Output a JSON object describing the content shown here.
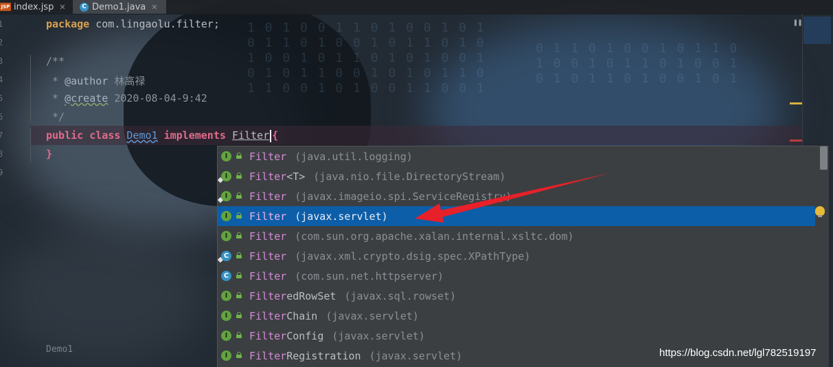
{
  "tabs": [
    {
      "label": "index.jsp",
      "icon": "JSP",
      "close": "✕"
    },
    {
      "label": "Demo1.java",
      "icon": "C",
      "close": "✕"
    }
  ],
  "line_numbers": [
    "1",
    "2",
    "3",
    "4",
    "5",
    "6",
    "7",
    "8",
    "9"
  ],
  "code": {
    "package_kw": "package",
    "package_name": " com.lingaolu.filter;",
    "doc_open": "/**",
    "author_prefix": " * ",
    "author_tag": "@author",
    "author_value": " 林高禄",
    "create_prefix": " * ",
    "create_tag": "@create",
    "create_value": " 2020-08-04-9:42",
    "doc_close": " */",
    "public_kw": "public",
    "class_kw": "class",
    "class_name": "Demo1",
    "implements_kw": "implements",
    "typed": "Filter",
    "open_brace": "{",
    "close_brace": "}"
  },
  "breadcrumb": "Demo1",
  "completion": {
    "items": [
      {
        "match": "Filter",
        "rest": "",
        "pkg": "(java.util.logging)",
        "icon": "I",
        "selected": false
      },
      {
        "match": "Filter",
        "rest": "<T>",
        "pkg": "(java.nio.file.DirectoryStream)",
        "icon": "I",
        "selected": false
      },
      {
        "match": "Filter",
        "rest": "",
        "pkg": "(javax.imageio.spi.ServiceRegistry)",
        "icon": "I",
        "selected": false
      },
      {
        "match": "Filter",
        "rest": "",
        "pkg": "(javax.servlet)",
        "icon": "I",
        "selected": true
      },
      {
        "match": "Filter",
        "rest": "",
        "pkg": "(com.sun.org.apache.xalan.internal.xsltc.dom)",
        "icon": "I",
        "selected": false
      },
      {
        "match": "Filter",
        "rest": "",
        "pkg": "(javax.xml.crypto.dsig.spec.XPathType)",
        "icon": "C",
        "selected": false
      },
      {
        "match": "Filter",
        "rest": "",
        "pkg": "(com.sun.net.httpserver)",
        "icon": "C",
        "selected": false
      },
      {
        "match": "Filter",
        "rest": "edRowSet",
        "pkg": "(javax.sql.rowset)",
        "icon": "I",
        "selected": false
      },
      {
        "match": "Filter",
        "rest": "Chain",
        "pkg": "(javax.servlet)",
        "icon": "I",
        "selected": false
      },
      {
        "match": "Filter",
        "rest": "Config",
        "pkg": "(javax.servlet)",
        "icon": "I",
        "selected": false
      },
      {
        "match": "Filter",
        "rest": "Registration",
        "pkg": "(javax.servlet)",
        "icon": "I",
        "selected": false
      }
    ]
  },
  "watermark": "https://blog.csdn.net/lgl782519197",
  "colors": {
    "accent": "#0d5ea8",
    "arrow": "#e8202a"
  }
}
